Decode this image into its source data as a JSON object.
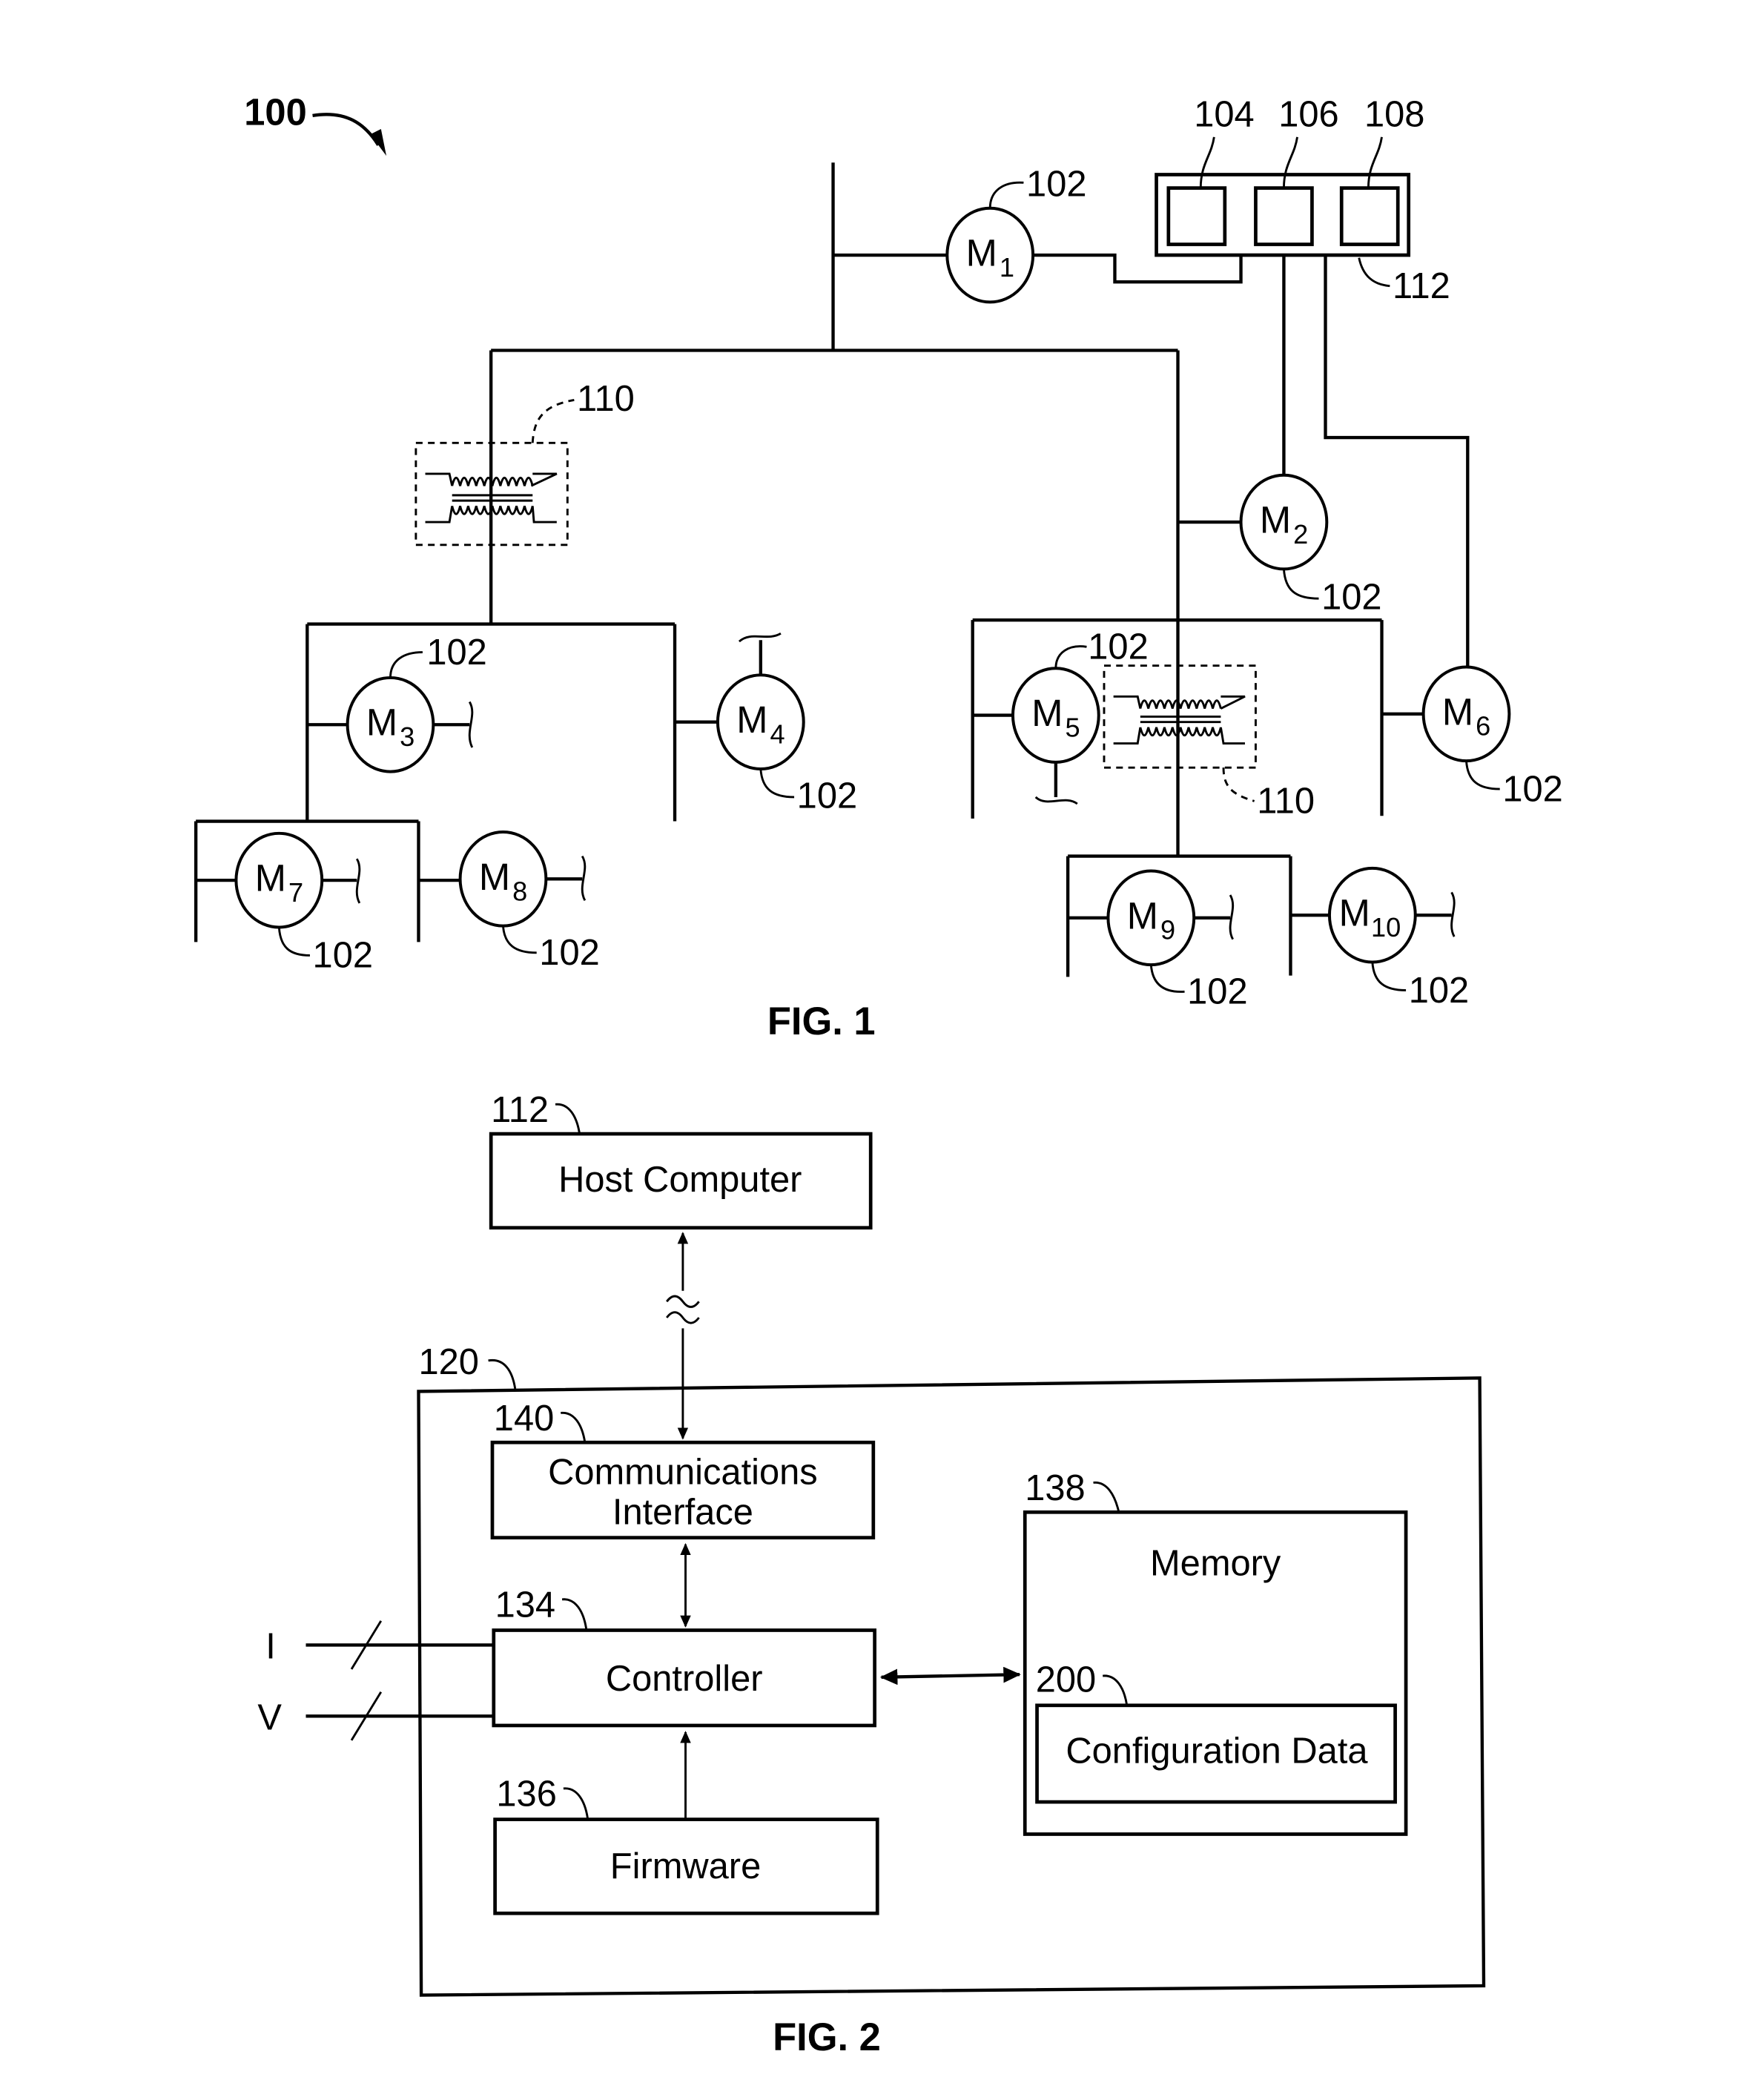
{
  "figure1": {
    "caption": "FIG. 1",
    "system_ref": "100",
    "host_refs": {
      "host": "112",
      "part_a": "104",
      "part_b": "106",
      "part_c": "108"
    },
    "transformer_ref": "110",
    "motor_ref": "102",
    "motors": [
      {
        "letter": "M",
        "index": "1"
      },
      {
        "letter": "M",
        "index": "2"
      },
      {
        "letter": "M",
        "index": "3"
      },
      {
        "letter": "M",
        "index": "4"
      },
      {
        "letter": "M",
        "index": "5"
      },
      {
        "letter": "M",
        "index": "6"
      },
      {
        "letter": "M",
        "index": "7"
      },
      {
        "letter": "M",
        "index": "8"
      },
      {
        "letter": "M",
        "index": "9"
      },
      {
        "letter": "M",
        "index": "10"
      }
    ]
  },
  "figure2": {
    "caption": "FIG. 2",
    "device_ref": "120",
    "blocks": {
      "host": {
        "ref": "112",
        "label": "Host Computer"
      },
      "comms": {
        "ref": "140",
        "label_line1": "Communications",
        "label_line2": "Interface"
      },
      "controller": {
        "ref": "134",
        "label": "Controller"
      },
      "firmware": {
        "ref": "136",
        "label": "Firmware"
      },
      "memory": {
        "ref": "138",
        "label": "Memory"
      },
      "config": {
        "ref": "200",
        "label": "Configuration Data"
      }
    },
    "inputs": {
      "current": "I",
      "voltage": "V"
    }
  }
}
